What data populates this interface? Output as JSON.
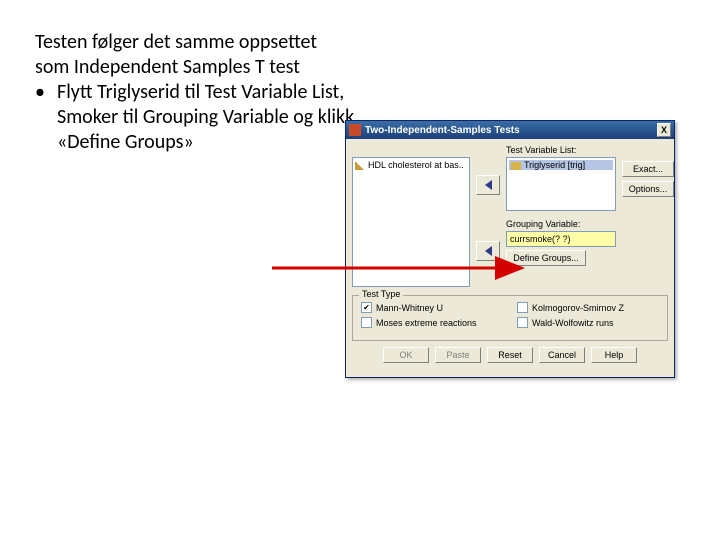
{
  "text": {
    "para": "Testen følger det samme oppsettet som Independent Samples T test",
    "bullet": "Flytt Triglyserid til Test Variable List, Smoker til Grouping Variable og klikk «Define Groups»"
  },
  "dialog": {
    "title": "Two-Independent-Samples Tests",
    "close_x": "X",
    "left_list_item": "HDL cholesterol at bas..",
    "tvl_label": "Test Variable List:",
    "tvl_item": "Triglyserid [trig]",
    "grp_label": "Grouping Variable:",
    "grp_value": "currsmoke(? ?)",
    "define_btn": "Define Groups...",
    "exact_btn": "Exact...",
    "options_btn": "Options...",
    "testtype_title": "Test Type",
    "chk_mw": "Mann-Whitney U",
    "chk_ks": "Kolmogorov-Smirnov Z",
    "chk_moses": "Moses extreme reactions",
    "chk_ww": "Wald-Wolfowitz runs",
    "btn_ok": "OK",
    "btn_paste": "Paste",
    "btn_reset": "Reset",
    "btn_cancel": "Cancel",
    "btn_help": "Help"
  }
}
